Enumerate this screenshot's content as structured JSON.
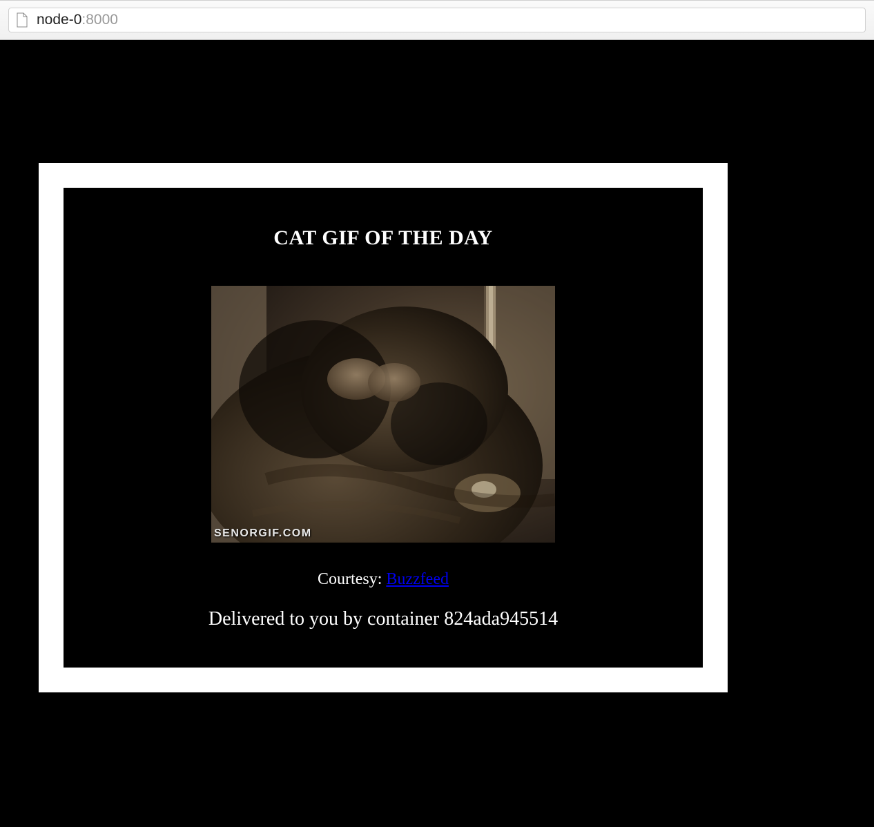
{
  "browser": {
    "url_host": "node-0",
    "url_port": ":8000"
  },
  "page": {
    "heading": "CAT GIF OF THE DAY",
    "image_watermark": "SENORGIF.COM",
    "image_alt": "cat-gif",
    "courtesy_label": "Courtesy: ",
    "courtesy_link_text": "Buzzfeed",
    "delivered_prefix": "Delivered to you by container ",
    "container_id": "824ada945514"
  }
}
